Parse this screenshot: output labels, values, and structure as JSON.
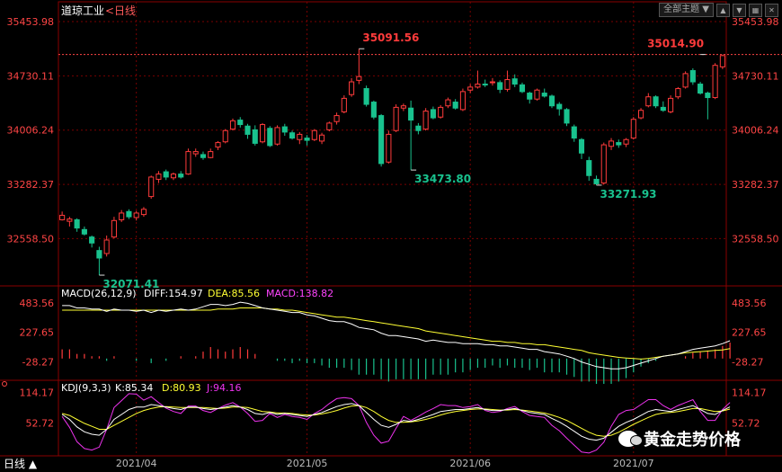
{
  "header": {
    "title": "道琼工业",
    "period": "<日线",
    "theme_label": "全部主题",
    "dropdown_arrow": "▼"
  },
  "colors": {
    "up": "#ff3b3b",
    "down": "#19c28e",
    "price_label": "#ff4545",
    "grid": "#7a0000",
    "dif": "#ffffff",
    "dea": "#ffff33",
    "macd_label": "#ff44ff",
    "kdj_k": "#ffffff",
    "kdj_d": "#ffff33",
    "kdj_j": "#ee33ee",
    "date_axis": "#bbbbbb"
  },
  "footer": {
    "period_label": "日线 ▲",
    "watermark": "黄金走势价格"
  },
  "chart_data": [
    {
      "type": "candlestick",
      "name": "price",
      "y_ticks": [
        "35453.98",
        "34730.11",
        "34006.24",
        "33282.37",
        "32558.50"
      ],
      "ylim": [
        32000,
        35453.98
      ],
      "grid": true,
      "reference_line": 35014.9,
      "x_labels": [
        "2021/04",
        "2021/05",
        "2021/06",
        "2021/07"
      ],
      "x_label_index": [
        10,
        33,
        55,
        77
      ],
      "annotations": [
        {
          "text": "35091.56",
          "index": 40,
          "value": 35091.56,
          "color": "up"
        },
        {
          "text": "35014.90",
          "index": 86,
          "value": 35014.9,
          "color": "up"
        },
        {
          "text": "32071.41",
          "index": 5,
          "value": 32071.41,
          "color": "down"
        },
        {
          "text": "33473.80",
          "index": 47,
          "value": 33473.8,
          "color": "down"
        },
        {
          "text": "33271.93",
          "index": 72,
          "value": 33271.93,
          "color": "down"
        }
      ],
      "candles": [
        [
          32810,
          32870,
          32920,
          32800
        ],
        [
          32790,
          32820,
          32850,
          32720
        ],
        [
          32810,
          32700,
          32830,
          32650
        ],
        [
          32680,
          32620,
          32720,
          32600
        ],
        [
          32580,
          32500,
          32600,
          32440
        ],
        [
          32400,
          32300,
          32450,
          32071.41
        ],
        [
          32360,
          32540,
          32600,
          32320
        ],
        [
          32580,
          32800,
          32850,
          32560
        ],
        [
          32810,
          32900,
          32940,
          32780
        ],
        [
          32920,
          32850,
          32950,
          32820
        ],
        [
          32840,
          32900,
          32930,
          32800
        ],
        [
          32880,
          32950,
          32980,
          32850
        ],
        [
          33120,
          33380,
          33400,
          33090
        ],
        [
          33350,
          33420,
          33460,
          33300
        ],
        [
          33450,
          33380,
          33480,
          33340
        ],
        [
          33370,
          33420,
          33440,
          33340
        ],
        [
          33420,
          33380,
          33460,
          33360
        ],
        [
          33420,
          33720,
          33760,
          33410
        ],
        [
          33690,
          33720,
          33760,
          33650
        ],
        [
          33680,
          33640,
          33720,
          33610
        ],
        [
          33640,
          33720,
          33760,
          33630
        ],
        [
          33780,
          33840,
          33860,
          33740
        ],
        [
          33850,
          34000,
          34020,
          33830
        ],
        [
          34020,
          34130,
          34160,
          34000
        ],
        [
          34140,
          34080,
          34180,
          34040
        ],
        [
          34060,
          33950,
          34090,
          33890
        ],
        [
          34010,
          33830,
          34070,
          33800
        ],
        [
          33850,
          34080,
          34100,
          33830
        ],
        [
          34030,
          33800,
          34060,
          33780
        ],
        [
          33820,
          34040,
          34070,
          33800
        ],
        [
          34050,
          33980,
          34090,
          33930
        ],
        [
          33970,
          33900,
          34000,
          33880
        ],
        [
          33880,
          33950,
          33980,
          33820
        ],
        [
          33900,
          33870,
          33940,
          33800
        ],
        [
          33880,
          34000,
          34020,
          33860
        ],
        [
          33860,
          33940,
          33970,
          33820
        ],
        [
          34010,
          34100,
          34120,
          33990
        ],
        [
          34120,
          34200,
          34240,
          34080
        ],
        [
          34250,
          34430,
          34470,
          34230
        ],
        [
          34480,
          34650,
          34700,
          34450
        ],
        [
          34670,
          34720,
          35091.56,
          34620
        ],
        [
          34560,
          34350,
          34600,
          34320
        ],
        [
          34380,
          34180,
          34400,
          34150
        ],
        [
          34200,
          33560,
          34220,
          33520
        ],
        [
          33580,
          33950,
          34000,
          33560
        ],
        [
          34000,
          34310,
          34350,
          33980
        ],
        [
          34300,
          34330,
          34360,
          34260
        ],
        [
          34300,
          34140,
          34400,
          33473.8
        ],
        [
          34060,
          34000,
          34100,
          33950
        ],
        [
          34020,
          34260,
          34300,
          34000
        ],
        [
          34280,
          34170,
          34320,
          34150
        ],
        [
          34180,
          34310,
          34340,
          34160
        ],
        [
          34330,
          34410,
          34440,
          34300
        ],
        [
          34380,
          34300,
          34420,
          34280
        ],
        [
          34280,
          34520,
          34560,
          34260
        ],
        [
          34540,
          34580,
          34620,
          34500
        ],
        [
          34580,
          34620,
          34800,
          34560
        ],
        [
          34620,
          34610,
          34680,
          34580
        ],
        [
          34640,
          34650,
          34700,
          34600
        ],
        [
          34640,
          34550,
          34670,
          34500
        ],
        [
          34550,
          34680,
          34800,
          34520
        ],
        [
          34690,
          34620,
          34750,
          34580
        ],
        [
          34610,
          34520,
          34640,
          34500
        ],
        [
          34500,
          34420,
          34520,
          34360
        ],
        [
          34420,
          34540,
          34560,
          34400
        ],
        [
          34500,
          34460,
          34560,
          34440
        ],
        [
          34460,
          34330,
          34480,
          34300
        ],
        [
          34350,
          34290,
          34380,
          34200
        ],
        [
          34280,
          34100,
          34300,
          34060
        ],
        [
          34050,
          33900,
          34080,
          33850
        ],
        [
          33880,
          33700,
          33900,
          33620
        ],
        [
          33600,
          33400,
          33650,
          33330
        ],
        [
          33350,
          33290,
          33400,
          33271.93
        ],
        [
          33300,
          33810,
          33840,
          33280
        ],
        [
          33790,
          33860,
          33900,
          33740
        ],
        [
          33840,
          33810,
          33880,
          33770
        ],
        [
          33820,
          33880,
          33900,
          33780
        ],
        [
          33900,
          34150,
          34180,
          33880
        ],
        [
          34170,
          34270,
          34300,
          34150
        ],
        [
          34330,
          34450,
          34500,
          34310
        ],
        [
          34450,
          34330,
          34470,
          34300
        ],
        [
          34310,
          34270,
          34390,
          34250
        ],
        [
          34250,
          34430,
          34470,
          34230
        ],
        [
          34450,
          34560,
          34580,
          34420
        ],
        [
          34580,
          34760,
          34790,
          34560
        ],
        [
          34800,
          34650,
          34830,
          34610
        ],
        [
          34620,
          34500,
          34650,
          34480
        ],
        [
          34500,
          34440,
          34520,
          34150
        ],
        [
          34440,
          34870,
          34900,
          34420
        ],
        [
          34850,
          35000,
          35014.9,
          34820
        ]
      ]
    },
    {
      "type": "line",
      "name": "macd",
      "indicator_title": "MACD(26,12,9)",
      "dif_label": "DIFF:154.97",
      "dea_label": "DEA:85.56",
      "macd_label": "MACD:138.82",
      "y_ticks": [
        "483.56",
        "227.65",
        "-28.27"
      ],
      "ylim": [
        -150,
        600
      ],
      "dif": [
        460,
        460,
        440,
        440,
        430,
        430,
        410,
        430,
        420,
        420,
        410,
        420,
        400,
        420,
        410,
        420,
        430,
        420,
        430,
        450,
        470,
        470,
        460,
        470,
        490,
        480,
        460,
        440,
        430,
        420,
        410,
        400,
        400,
        380,
        370,
        350,
        330,
        320,
        320,
        300,
        270,
        260,
        250,
        220,
        200,
        200,
        190,
        180,
        170,
        150,
        160,
        150,
        140,
        140,
        130,
        130,
        130,
        120,
        120,
        110,
        110,
        100,
        90,
        80,
        80,
        60,
        50,
        40,
        20,
        0,
        -30,
        -50,
        -70,
        -80,
        -90,
        -90,
        -80,
        -60,
        -40,
        -20,
        0,
        20,
        30,
        40,
        60,
        80,
        90,
        100,
        110,
        130,
        154.97
      ],
      "dea": [
        420,
        420,
        420,
        420,
        420,
        420,
        420,
        420,
        420,
        420,
        420,
        420,
        420,
        420,
        420,
        420,
        420,
        420,
        420,
        420,
        420,
        430,
        430,
        430,
        440,
        440,
        440,
        440,
        430,
        430,
        420,
        420,
        410,
        400,
        390,
        380,
        370,
        360,
        360,
        350,
        340,
        330,
        320,
        310,
        300,
        290,
        280,
        270,
        260,
        240,
        230,
        220,
        210,
        200,
        190,
        180,
        170,
        160,
        150,
        150,
        140,
        140,
        130,
        130,
        120,
        120,
        110,
        100,
        90,
        80,
        70,
        50,
        40,
        30,
        20,
        10,
        5,
        0,
        -5,
        0,
        10,
        20,
        30,
        40,
        50,
        55,
        60,
        65,
        70,
        75,
        85.56
      ],
      "hist": [
        80,
        80,
        40,
        40,
        20,
        20,
        -20,
        20,
        0,
        0,
        -20,
        0,
        -40,
        0,
        -20,
        0,
        20,
        0,
        20,
        60,
        100,
        80,
        60,
        80,
        100,
        80,
        40,
        0,
        0,
        -20,
        -20,
        -40,
        -20,
        -40,
        -40,
        -60,
        -80,
        -80,
        -80,
        -100,
        -140,
        -140,
        -140,
        -180,
        -200,
        -180,
        -180,
        -180,
        -180,
        -180,
        -140,
        -140,
        -140,
        -120,
        -120,
        -100,
        -80,
        -80,
        -60,
        -80,
        -60,
        -80,
        -80,
        -100,
        -80,
        -120,
        -120,
        -120,
        -140,
        -160,
        -200,
        -200,
        -220,
        -220,
        -220,
        -200,
        -170,
        -120,
        -70,
        -40,
        -20,
        0,
        0,
        0,
        20,
        50,
        60,
        70,
        80,
        110,
        138.82
      ]
    },
    {
      "type": "line",
      "name": "kdj",
      "indicator_title": "KDJ(9,3,3)",
      "k_label": "K:85.34",
      "d_label": "D:80.93",
      "j_label": "J:94.16",
      "y_ticks": [
        "114.17",
        "52.72"
      ],
      "ylim": [
        -10,
        130
      ],
      "k": [
        70,
        60,
        45,
        35,
        30,
        28,
        40,
        60,
        70,
        80,
        85,
        85,
        90,
        88,
        85,
        82,
        80,
        85,
        85,
        82,
        80,
        82,
        85,
        88,
        85,
        80,
        72,
        70,
        74,
        70,
        72,
        70,
        68,
        66,
        70,
        74,
        80,
        86,
        90,
        92,
        88,
        74,
        60,
        48,
        44,
        50,
        58,
        56,
        60,
        65,
        70,
        76,
        78,
        80,
        80,
        82,
        84,
        80,
        78,
        78,
        80,
        82,
        78,
        74,
        72,
        70,
        62,
        55,
        46,
        36,
        26,
        20,
        18,
        22,
        34,
        46,
        54,
        60,
        68,
        76,
        80,
        78,
        76,
        80,
        84,
        88,
        80,
        72,
        70,
        78,
        85.34
      ],
      "d": [
        72,
        68,
        60,
        52,
        46,
        40,
        40,
        48,
        56,
        64,
        72,
        78,
        82,
        85,
        86,
        85,
        84,
        84,
        84,
        84,
        83,
        82,
        83,
        85,
        85,
        84,
        80,
        76,
        75,
        73,
        73,
        72,
        70,
        69,
        69,
        71,
        74,
        78,
        83,
        87,
        88,
        84,
        76,
        66,
        58,
        54,
        54,
        55,
        57,
        60,
        64,
        69,
        73,
        76,
        78,
        80,
        81,
        81,
        80,
        79,
        79,
        80,
        79,
        77,
        75,
        73,
        69,
        64,
        58,
        50,
        42,
        34,
        28,
        26,
        28,
        34,
        42,
        50,
        57,
        64,
        70,
        73,
        74,
        76,
        79,
        82,
        82,
        79,
        76,
        77,
        80.93
      ],
      "j": [
        66,
        44,
        15,
        1,
        -2,
        4,
        40,
        84,
        98,
        112,
        111,
        99,
        106,
        94,
        83,
        76,
        72,
        87,
        87,
        78,
        74,
        82,
        89,
        94,
        85,
        72,
        56,
        58,
        72,
        64,
        70,
        66,
        64,
        60,
        72,
        80,
        92,
        102,
        104,
        102,
        88,
        54,
        28,
        12,
        16,
        42,
        66,
        58,
        66,
        75,
        82,
        90,
        88,
        88,
        84,
        86,
        90,
        78,
        74,
        76,
        82,
        86,
        76,
        68,
        66,
        64,
        48,
        37,
        22,
        8,
        -6,
        -8,
        -2,
        14,
        46,
        70,
        78,
        80,
        90,
        100,
        100,
        88,
        80,
        88,
        94,
        100,
        76,
        58,
        58,
        80,
        94.16
      ]
    }
  ]
}
